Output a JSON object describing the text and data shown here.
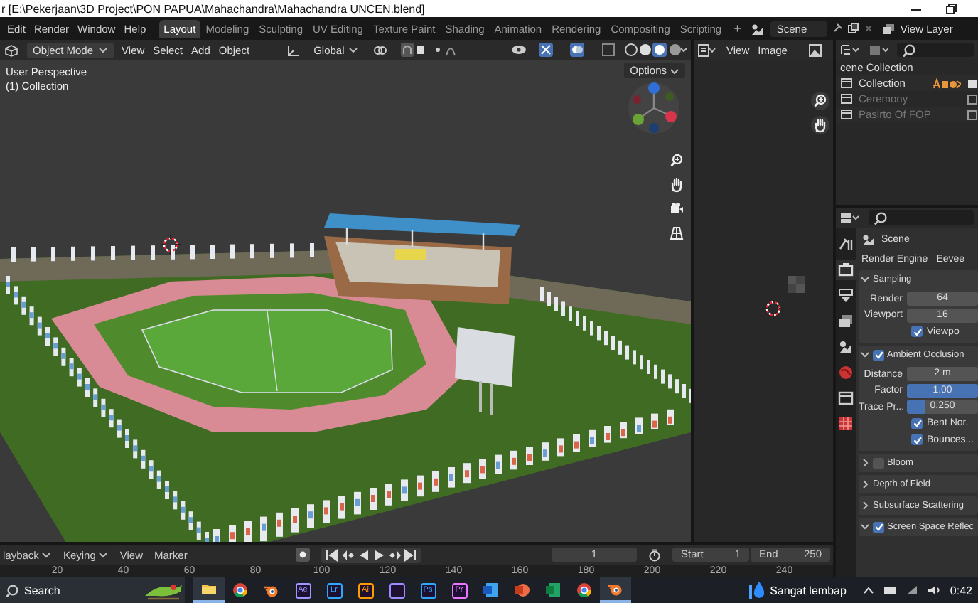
{
  "window": {
    "title": "r [E:\\Pekerjaan\\3D Project\\PON PAPUA\\Mahachandra\\Mahachandra UNCEN.blend]"
  },
  "menu": [
    "Edit",
    "Render",
    "Window",
    "Help"
  ],
  "workspaces": [
    {
      "label": "Layout",
      "selected": true
    },
    {
      "label": "Modeling",
      "selected": false
    },
    {
      "label": "Sculpting",
      "selected": false
    },
    {
      "label": "UV Editing",
      "selected": false
    },
    {
      "label": "Texture Paint",
      "selected": false
    },
    {
      "label": "Shading",
      "selected": false
    },
    {
      "label": "Animation",
      "selected": false
    },
    {
      "label": "Rendering",
      "selected": false
    },
    {
      "label": "Compositing",
      "selected": false
    },
    {
      "label": "Scripting",
      "selected": false
    }
  ],
  "add_workspace": "+",
  "scene": "Scene",
  "view_layer": "View Layer",
  "viewport": {
    "mode": "Object Mode",
    "menus": [
      "View",
      "Select",
      "Add",
      "Object"
    ],
    "orientation": "Global",
    "options": "Options",
    "overlay": [
      "User Perspective",
      "(1) Collection"
    ]
  },
  "image_editor": {
    "menus": [
      "View",
      "Image"
    ]
  },
  "outliner": {
    "root": "cene Collection",
    "items": [
      {
        "name": "Collection",
        "excluded": false
      },
      {
        "name": "Ceremony",
        "excluded": true
      },
      {
        "name": "Pasirto Of FOP",
        "excluded": true
      }
    ]
  },
  "properties": {
    "tabs": [
      {
        "kind": "tool",
        "selected": false
      },
      {
        "kind": "render",
        "selected": true
      },
      {
        "kind": "output",
        "selected": false
      },
      {
        "kind": "view_layer",
        "selected": false
      },
      {
        "kind": "scene",
        "selected": false
      },
      {
        "kind": "world",
        "selected": false
      },
      {
        "kind": "collection",
        "selected": false
      },
      {
        "kind": "texture",
        "selected": false
      }
    ],
    "breadcrumb": "Scene",
    "engine_label": "Render Engine",
    "engine": "Eevee",
    "panels": [
      {
        "title": "Sampling",
        "kind": "plain",
        "expanded": true,
        "rows": [
          {
            "kind": "number",
            "label": "Render",
            "value": "64"
          },
          {
            "kind": "number",
            "label": "Viewport",
            "value": "16"
          },
          {
            "kind": "check",
            "label": "Viewpo",
            "checked": true
          }
        ]
      },
      {
        "title": "Ambient Occlusion",
        "kind": "toggle",
        "checked": true,
        "expanded": true,
        "rows": [
          {
            "kind": "number",
            "label": "Distance",
            "value": "2 m"
          },
          {
            "kind": "slider",
            "label": "Factor",
            "value": "1.00",
            "level": 1
          },
          {
            "kind": "slider",
            "label": "Trace Pr...",
            "value": "0.250",
            "level": 0.25
          },
          {
            "kind": "check",
            "label": "Bent Nor.",
            "checked": true
          },
          {
            "kind": "check",
            "label": "Bounces...",
            "checked": true
          }
        ]
      },
      {
        "title": "Bloom",
        "kind": "toggle",
        "checked": false,
        "expanded": false
      },
      {
        "title": "Depth of Field",
        "kind": "plain",
        "expanded": false
      },
      {
        "title": "Subsurface Scattering",
        "kind": "plain",
        "expanded": false
      },
      {
        "title": "Screen Space Reflec",
        "kind": "toggle",
        "checked": true,
        "expanded": true
      }
    ]
  },
  "timeline": {
    "menus": [
      "layback",
      "Keying",
      "View",
      "Marker"
    ],
    "frame": "1",
    "start_label": "Start",
    "start": "1",
    "end_label": "End",
    "end": "250",
    "ruler": [
      "20",
      "40",
      "60",
      "80",
      "100",
      "120",
      "140",
      "160",
      "180",
      "200",
      "220",
      "240"
    ]
  },
  "taskbar": {
    "search": "Search",
    "apps": [
      {
        "kind": "folder",
        "active": true
      },
      {
        "kind": "chrome",
        "active": false
      },
      {
        "kind": "blender",
        "active": false
      },
      {
        "kind": "tile",
        "glyph": "Ae",
        "color": "#9999ff",
        "active": false
      },
      {
        "kind": "tile",
        "glyph": "Lr",
        "color": "#31a8ff",
        "active": false
      },
      {
        "kind": "tile",
        "glyph": "Ai",
        "color": "#ff9a00",
        "active": false
      },
      {
        "kind": "tile",
        "color": "#9b8cff",
        "active": false
      },
      {
        "kind": "tile",
        "glyph": "Ps",
        "color": "#31a8ff",
        "active": false
      },
      {
        "kind": "tile",
        "glyph": "Pr",
        "color": "#ea77ff",
        "active": false
      },
      {
        "kind": "word",
        "active": false
      },
      {
        "kind": "powerpoint",
        "active": false
      },
      {
        "kind": "excel",
        "active": false
      },
      {
        "kind": "chrome",
        "active": false
      },
      {
        "kind": "blender",
        "active": true
      }
    ],
    "weather": "Sangat lembap",
    "clock": "0:42"
  }
}
